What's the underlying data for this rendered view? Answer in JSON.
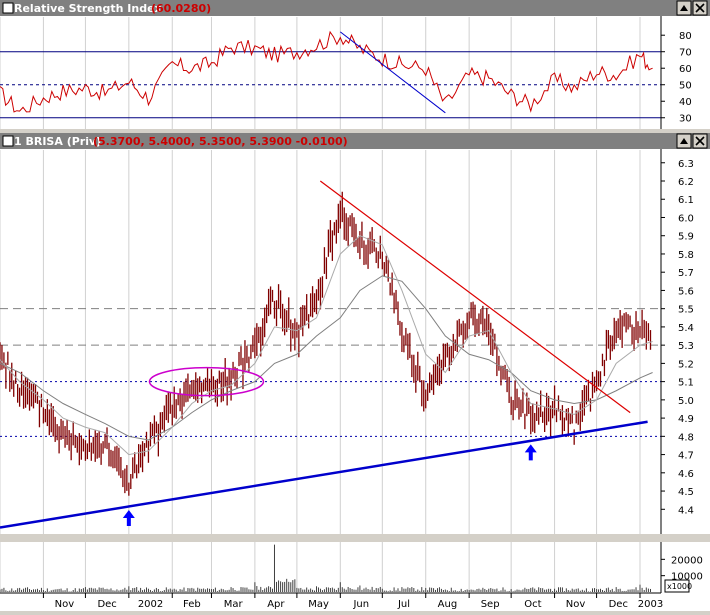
{
  "rsi_panel": {
    "title": "Relative Strength Index",
    "value": "(60.0280)",
    "title_bg": "#808080",
    "value_color": "#cc0000",
    "line_color": "#cc0000"
  },
  "price_panel": {
    "title": "1 BRISA (Priv)",
    "values": "(5.3700, 5.4000, 5.3500, 5.3900 -0.0100)",
    "title_bg": "#808080",
    "value_color": "#cc0000",
    "bar_color": "#800000"
  },
  "volume_panel": {
    "multiplier": "x1000"
  },
  "window_controls": {
    "up_icon": "arrow-up-icon",
    "close_icon": "close-icon"
  },
  "chart_data": [
    {
      "type": "line",
      "name": "rsi",
      "title": "Relative Strength Index",
      "current_value": 60.028,
      "ylim": [
        25,
        88
      ],
      "yticks": [
        30,
        40,
        50,
        60,
        70,
        80
      ],
      "reference_lines": [
        30,
        50,
        70
      ],
      "x": [
        "2001-10-01",
        "2001-10-15",
        "2001-11-01",
        "2001-11-15",
        "2001-12-01",
        "2001-12-15",
        "2002-01-01",
        "2002-01-15",
        "2002-02-01",
        "2002-02-15",
        "2002-03-01",
        "2002-03-15",
        "2002-04-01",
        "2002-04-15",
        "2002-05-01",
        "2002-05-15",
        "2002-06-01",
        "2002-06-15",
        "2002-07-01",
        "2002-07-15",
        "2002-08-01",
        "2002-08-15",
        "2002-09-01",
        "2002-09-15",
        "2002-10-01",
        "2002-10-15",
        "2002-11-01",
        "2002-11-15",
        "2002-12-01",
        "2002-12-15",
        "2003-01-01",
        "2003-01-10"
      ],
      "values": [
        45,
        34,
        42,
        46,
        48,
        45,
        52,
        42,
        62,
        60,
        63,
        73,
        72,
        68,
        70,
        74,
        80,
        72,
        66,
        62,
        60,
        38,
        56,
        54,
        44,
        38,
        53,
        48,
        58,
        56,
        68,
        60
      ],
      "trendline": {
        "from": [
          "2002-06-01",
          82
        ],
        "to": [
          "2002-08-15",
          33
        ],
        "color": "#0000cc"
      }
    },
    {
      "type": "bar",
      "name": "price",
      "title": "1 BRISA (Priv)",
      "last": {
        "open": 5.37,
        "high": 5.4,
        "low": 5.35,
        "close": 5.39,
        "change": -0.01
      },
      "ylim": [
        4.27,
        6.37
      ],
      "yticks": [
        4.4,
        4.5,
        4.6,
        4.7,
        4.8,
        4.9,
        5.0,
        5.1,
        5.2,
        5.3,
        5.4,
        5.5,
        5.6,
        5.7,
        5.8,
        5.9,
        6.0,
        6.1,
        6.2,
        6.3
      ],
      "x": [
        "2001-10-01",
        "2001-10-15",
        "2001-11-01",
        "2001-11-15",
        "2001-12-01",
        "2001-12-15",
        "2002-01-01",
        "2002-01-15",
        "2002-02-01",
        "2002-02-15",
        "2002-03-01",
        "2002-03-15",
        "2002-04-01",
        "2002-04-15",
        "2002-05-01",
        "2002-05-15",
        "2002-06-01",
        "2002-06-15",
        "2002-07-01",
        "2002-07-15",
        "2002-08-01",
        "2002-08-15",
        "2002-09-01",
        "2002-09-15",
        "2002-10-01",
        "2002-10-15",
        "2002-11-01",
        "2002-11-15",
        "2002-12-01",
        "2002-12-15",
        "2003-01-01",
        "2003-01-10"
      ],
      "close": [
        5.25,
        5.05,
        4.95,
        4.8,
        4.77,
        4.75,
        4.55,
        4.75,
        4.95,
        5.05,
        5.08,
        5.1,
        5.3,
        5.55,
        5.35,
        5.55,
        6.05,
        5.85,
        5.8,
        5.4,
        5.0,
        5.25,
        5.45,
        5.4,
        5.0,
        4.9,
        4.95,
        4.85,
        5.1,
        5.4,
        5.38,
        5.39
      ],
      "moving_averages": [
        {
          "values": [
            5.2,
            5.15,
            5.05,
            4.98,
            4.92,
            4.87,
            4.8,
            4.78,
            4.85,
            4.93,
            5.0,
            5.05,
            5.1,
            5.2,
            5.25,
            5.35,
            5.45,
            5.6,
            5.68,
            5.65,
            5.5,
            5.35,
            5.25,
            5.22,
            5.15,
            5.05,
            5.0,
            4.98,
            5.0,
            5.05,
            5.12,
            5.15
          ],
          "color": "#808080"
        },
        {
          "values": [
            5.22,
            5.1,
            5.0,
            4.9,
            4.85,
            4.82,
            4.7,
            4.72,
            4.85,
            4.98,
            5.05,
            5.08,
            5.2,
            5.4,
            5.38,
            5.45,
            5.8,
            5.9,
            5.85,
            5.6,
            5.25,
            5.15,
            5.35,
            5.38,
            5.15,
            4.98,
            4.95,
            4.92,
            5.0,
            5.2,
            5.3,
            5.32
          ],
          "color": "#aaaaaa"
        }
      ],
      "reference_lines": [
        {
          "y": 5.5,
          "style": "dashed",
          "color": "#808080"
        },
        {
          "y": 5.3,
          "style": "dashed",
          "color": "#808080"
        },
        {
          "y": 5.1,
          "style": "dotted",
          "color": "#0000aa"
        },
        {
          "y": 4.8,
          "style": "dotted",
          "color": "#0000aa"
        }
      ],
      "support_trendline": {
        "from": [
          "2001-10-01",
          4.3
        ],
        "to": [
          "2003-01-10",
          4.88
        ],
        "color": "#0000cc"
      },
      "resistance_trendline": {
        "from": [
          "2002-06-01",
          6.2
        ],
        "to": [
          "2002-12-25",
          4.93
        ],
        "color": "#dd0000"
      },
      "ellipse": {
        "center": [
          "2002-03-01",
          5.1
        ],
        "color": "#cc00cc"
      },
      "arrows": [
        [
          "2002-01-01",
          4.33
        ],
        [
          "2002-10-15",
          4.69
        ]
      ]
    },
    {
      "type": "bar",
      "name": "volume",
      "multiplier": "x1000",
      "yticks": [
        20000,
        10000
      ],
      "x": [
        "2001-10-01",
        "2001-10-15",
        "2001-11-01",
        "2001-11-15",
        "2001-12-01",
        "2001-12-15",
        "2002-01-01",
        "2002-01-15",
        "2002-02-01",
        "2002-02-15",
        "2002-03-01",
        "2002-03-15",
        "2002-04-01",
        "2002-04-15",
        "2002-05-01",
        "2002-05-15",
        "2002-06-01",
        "2002-06-15",
        "2002-07-01",
        "2002-07-15",
        "2002-08-01",
        "2002-08-15",
        "2002-09-01",
        "2002-09-15",
        "2002-10-01",
        "2002-10-15",
        "2002-11-01",
        "2002-11-15",
        "2002-12-01",
        "2002-12-15",
        "2003-01-01",
        "2003-01-10"
      ],
      "values": [
        1500,
        2500,
        1200,
        1000,
        3000,
        1800,
        3500,
        2000,
        1500,
        2500,
        1800,
        3000,
        6000,
        29000,
        2500,
        3500,
        6000,
        4000,
        2000,
        3000,
        2500,
        1500,
        1200,
        2000,
        1800,
        2500,
        2000,
        1500,
        1800,
        3000,
        4500,
        2000
      ]
    }
  ],
  "x_axis": {
    "labels": [
      "Nov",
      "Dec",
      "2002",
      "Feb",
      "Mar",
      "Apr",
      "May",
      "Jun",
      "Jul",
      "Aug",
      "Sep",
      "Oct",
      "Nov",
      "Dec",
      "2003"
    ]
  }
}
